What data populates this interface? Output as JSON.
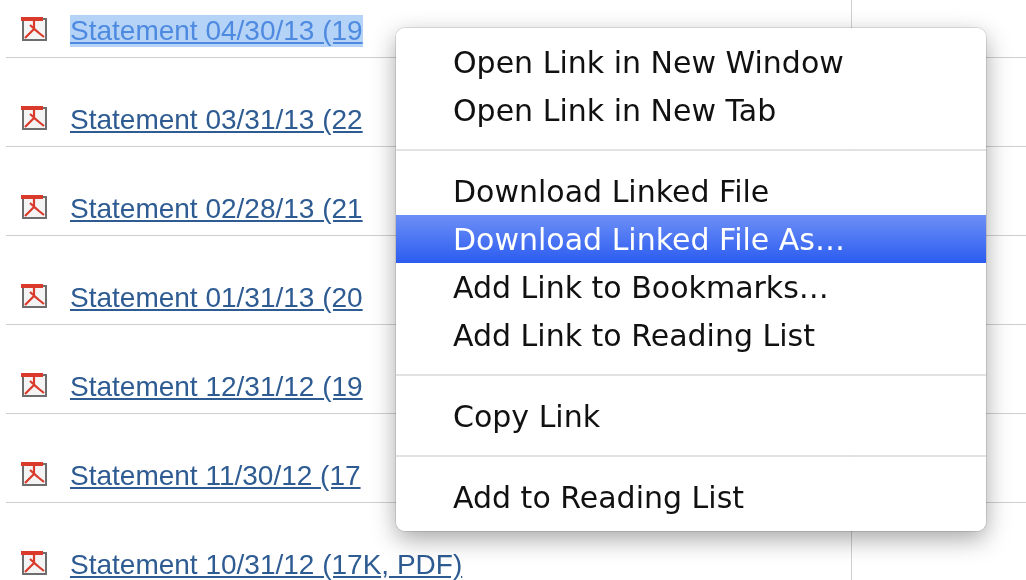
{
  "statements": [
    {
      "label": "Statement 04/30/13 (19",
      "selected": true
    },
    {
      "label": "Statement 03/31/13 (22",
      "selected": false
    },
    {
      "label": "Statement 02/28/13 (21",
      "selected": false
    },
    {
      "label": "Statement 01/31/13 (20",
      "selected": false
    },
    {
      "label": "Statement 12/31/12 (19",
      "selected": false
    },
    {
      "label": "Statement 11/30/12 (17",
      "selected": false
    },
    {
      "label": "Statement 10/31/12 (17K, PDF)",
      "selected": false
    }
  ],
  "context_menu": [
    {
      "kind": "item",
      "label": "Open Link in New Window",
      "selected": false
    },
    {
      "kind": "item",
      "label": "Open Link in New Tab",
      "selected": false
    },
    {
      "kind": "separator"
    },
    {
      "kind": "item",
      "label": "Download Linked File",
      "selected": false
    },
    {
      "kind": "item",
      "label": "Download Linked File As…",
      "selected": true
    },
    {
      "kind": "item",
      "label": "Add Link to Bookmarks…",
      "selected": false
    },
    {
      "kind": "item",
      "label": "Add Link to Reading List",
      "selected": false
    },
    {
      "kind": "separator"
    },
    {
      "kind": "item",
      "label": "Copy Link",
      "selected": false
    },
    {
      "kind": "separator"
    },
    {
      "kind": "item",
      "label": "Add to Reading List",
      "selected": false
    }
  ]
}
